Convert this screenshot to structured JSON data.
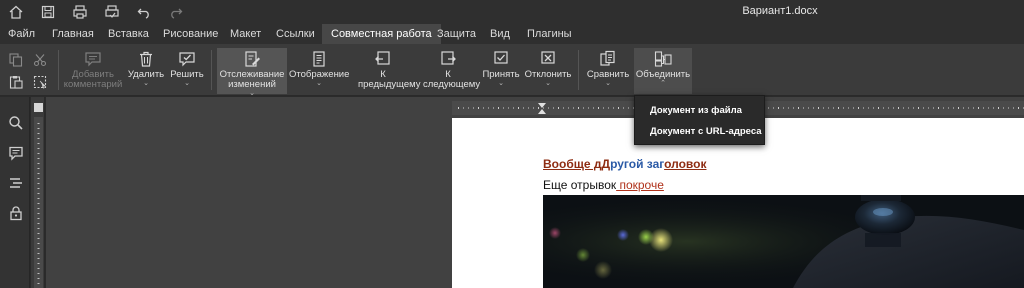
{
  "titlebar": {
    "document_title": "Вариант1.docx",
    "icons": [
      "home-icon",
      "save-icon",
      "print-icon",
      "quick-print-icon",
      "undo-icon",
      "redo-icon"
    ]
  },
  "menu": {
    "items": [
      "Файл",
      "Главная",
      "Вставка",
      "Рисование",
      "Макет",
      "Ссылки",
      "Совместная работа",
      "Защита",
      "Вид",
      "Плагины"
    ],
    "active": "Совместная работа"
  },
  "ribbon": {
    "add_comment": "Добавить комментарий",
    "delete": "Удалить",
    "resolve": "Решить",
    "track_changes": "Отслеживание изменений",
    "display": "Отображение",
    "previous": "К предыдущему",
    "next": "К следующему",
    "accept": "Принять",
    "reject": "Отклонить",
    "compare": "Сравнить",
    "combine": "Объединить"
  },
  "dropdown": {
    "items": [
      "Документ из файла",
      "Документ с URL-адреса"
    ]
  },
  "document": {
    "heading_deleted_1": "Вообще д",
    "heading_deleted_2": "Д",
    "heading_inserted": "ругой заг",
    "heading_deleted_3": "оловок",
    "line2_text": "Еще отрывок",
    "line2_inserted": " покроче"
  },
  "colors": {
    "accent_active_tab": "#474747",
    "tracked_deletion": "#8e2c12",
    "tracked_insertion": "#2b5aa6"
  }
}
